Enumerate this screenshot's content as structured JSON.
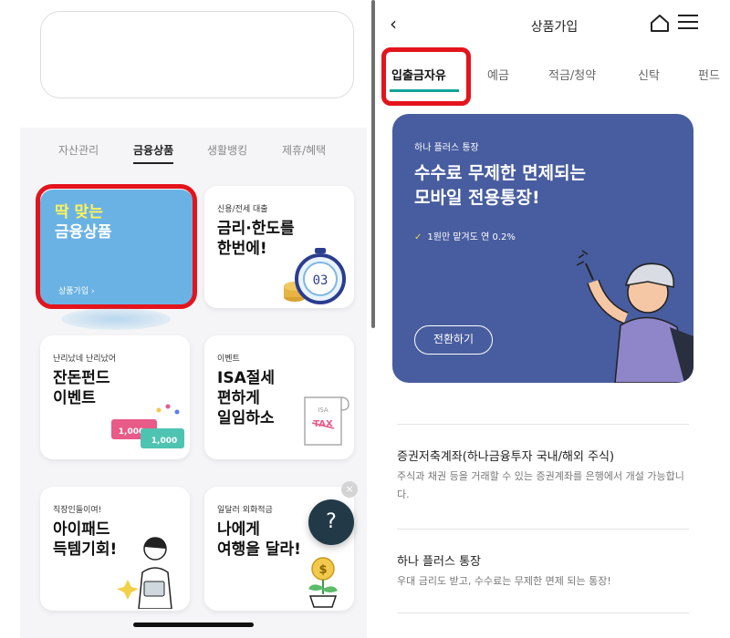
{
  "left": {
    "tabs": [
      "자산관리",
      "금융상품",
      "생활뱅킹",
      "제휴/혜택"
    ],
    "featured": {
      "line1_accent": "딱 맞는",
      "line2": "금융상품",
      "link": "상품가입 ›"
    },
    "cards": [
      {
        "small": "신용/전세 대출",
        "big1": "금리·한도를",
        "big2": "한번에!"
      },
      {
        "small": "난리났네 난리났어",
        "big1": "잔돈펀드",
        "big2": "이벤트"
      },
      {
        "small": "이벤트",
        "big1": "ISA절세",
        "big2": "편하게",
        "big3": "일임하소"
      },
      {
        "small": "직장인들이여!",
        "big1": "아이패드",
        "big2": "득템기회!"
      },
      {
        "small": "일달러 외화적금",
        "big1": "나에게",
        "big2": "여행을 달라!"
      }
    ],
    "stopwatch_text": "03",
    "ticket_values": [
      "1,000",
      "1,000"
    ],
    "tax_text": "TAX",
    "isa_text": "ISA",
    "dollar_sign": "$",
    "help_label": "?",
    "close_label": "×"
  },
  "right": {
    "header": {
      "back": "‹",
      "title": "상품가입"
    },
    "tabs": [
      "입출금자유",
      "예금",
      "적금/청약",
      "신탁",
      "펀드"
    ],
    "promo": {
      "sub": "하나 플러스 통장",
      "head1": "수수료 무제한 면제되는",
      "head2": "모바일 전용통장!",
      "check": "1원만 맡겨도 연 0.2%",
      "check_mark": "✓",
      "button": "전환하기"
    },
    "products": [
      {
        "title": "증권저축계좌(하나금융투자 국내/해외 주식)",
        "desc": "주식과 채권 등을 거래할 수 있는 증권계좌를 은행에서 개설 가능합니다."
      },
      {
        "title": "하나 플러스 통장",
        "desc": "우대 금리도 받고, 수수료는 무제한 면제 되는 통장!"
      }
    ]
  },
  "colors": {
    "accent_teal": "#12a49a",
    "highlight_red": "#e3141c",
    "promo_bg": "#485d9f",
    "featured_bg": "#6ab2e4"
  }
}
